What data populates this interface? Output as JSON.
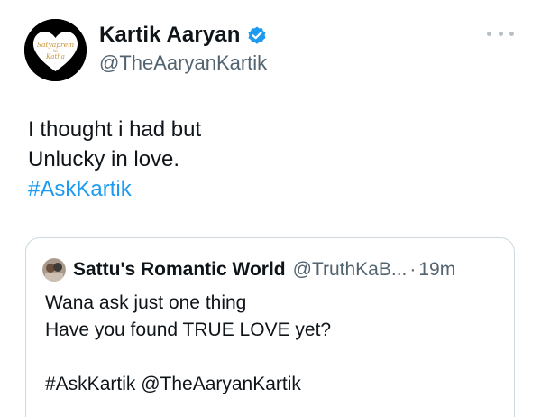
{
  "author": {
    "name": "Kartik Aaryan",
    "handle": "@TheAaryanKartik",
    "verified": true,
    "avatar_logo_text": "Satyaprem ki Katha"
  },
  "tweet": {
    "line1": "I thought i had but",
    "line2": "Unlucky in love.",
    "hashtag": "#AskKartik"
  },
  "quoted_tweet": {
    "name": "Sattu's Romantic World",
    "handle": "@TruthKaB...",
    "separator": "·",
    "time": "19m",
    "line1": "Wana ask just one thing",
    "line2": "Have you found TRUE LOVE yet?",
    "line3": "#AskKartik @TheAaryanKartik"
  },
  "icons": {
    "verified": "verified-badge-icon",
    "more": "more-dots-icon"
  },
  "colors": {
    "link": "#1d9bf0",
    "secondary_text": "#536471",
    "border": "#cfd9de",
    "verified": "#1d9bf0"
  }
}
